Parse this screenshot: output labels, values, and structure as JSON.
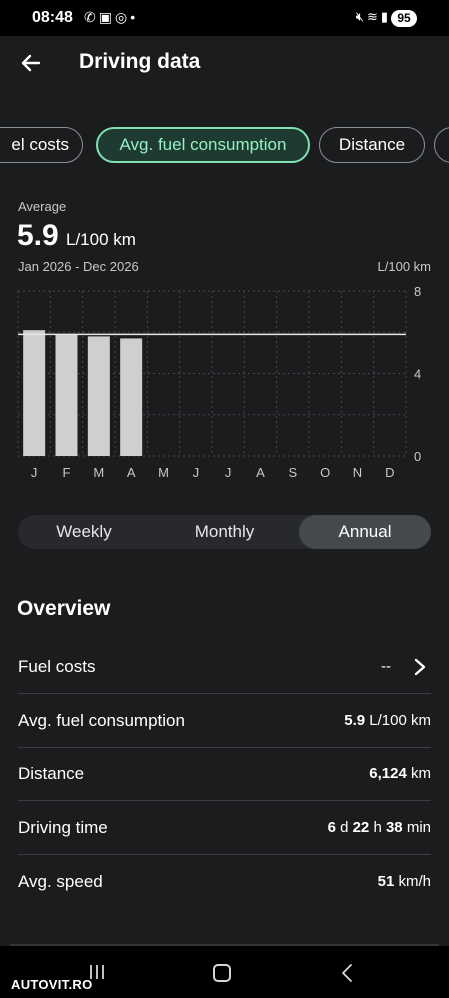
{
  "status_bar": {
    "time": "08:48",
    "left_icons": [
      "whatsapp-icon",
      "scan-icon",
      "instagram-icon",
      "notification-dot-icon"
    ],
    "right_icons": [
      "mute-icon",
      "wifi-icon",
      "signal-icon"
    ],
    "battery": "95"
  },
  "header": {
    "title": "Driving data"
  },
  "chips": [
    {
      "label": "Fuel costs",
      "visible_text": "el costs",
      "selected": false
    },
    {
      "label": "Avg. fuel consumption",
      "selected": true
    },
    {
      "label": "Distance",
      "selected": false
    }
  ],
  "summary": {
    "label": "Average",
    "value": "5.9",
    "unit": "L/100 km",
    "range": "Jan 2026 - Dec 2026",
    "axis_unit": "L/100 km"
  },
  "chart_data": {
    "type": "bar",
    "categories": [
      "J",
      "F",
      "M",
      "A",
      "M",
      "J",
      "J",
      "A",
      "S",
      "O",
      "N",
      "D"
    ],
    "values": [
      6.1,
      5.9,
      5.8,
      5.7,
      null,
      null,
      null,
      null,
      null,
      null,
      null,
      null
    ],
    "average_line": 5.9,
    "ylim": [
      0,
      8
    ],
    "yticks": [
      "8",
      "4",
      "0"
    ],
    "grid": true,
    "colors": {
      "bar": "#cfcfcf",
      "average_line": "#e8e8e8",
      "grid": "#45474a",
      "tick": "#c8c8c8"
    }
  },
  "period_tabs": {
    "weekly": "Weekly",
    "monthly": "Monthly",
    "annual": "Annual",
    "selected": "Annual"
  },
  "overview": {
    "title": "Overview",
    "fuel_costs": {
      "label": "Fuel costs",
      "value": "--"
    },
    "avg_fuel": {
      "label": "Avg. fuel consumption",
      "value": "5.9",
      "unit": "L/100 km"
    },
    "distance": {
      "label": "Distance",
      "value": "6,124",
      "unit": "km"
    },
    "driving_time": {
      "label": "Driving time",
      "days": "6",
      "days_unit": "d",
      "hours": "22",
      "hours_unit": "h",
      "minutes": "38",
      "minutes_unit": "min"
    },
    "avg_speed": {
      "label": "Avg. speed",
      "value": "51",
      "unit": "km/h"
    }
  },
  "watermark": "AUTOVIT.RO",
  "colors": {
    "accent": "#7fe0b2",
    "background": "#1b1c1e"
  }
}
